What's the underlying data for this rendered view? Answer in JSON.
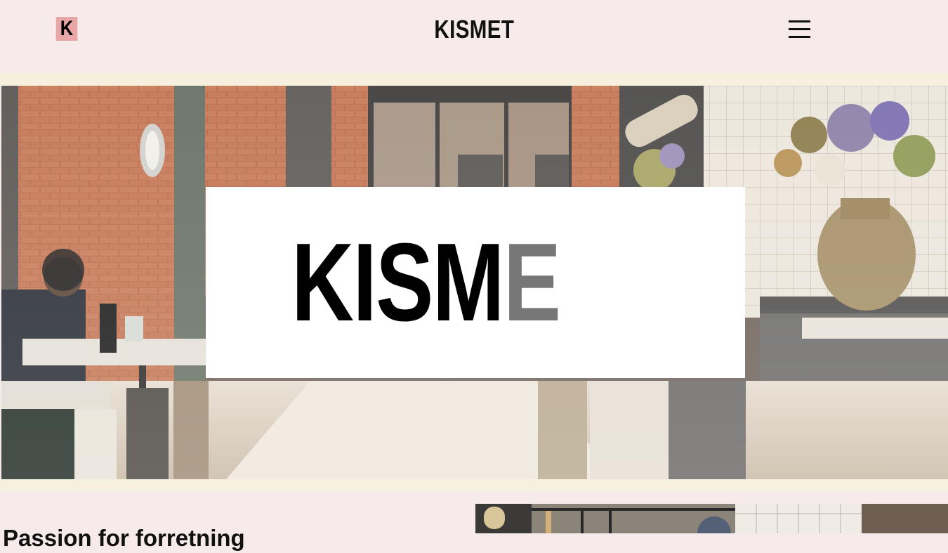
{
  "header": {
    "logo_letter": "K",
    "title": "KISMET",
    "menu_icon": "hamburger-menu-icon"
  },
  "hero": {
    "image_description_icon": "restaurant-interior-photo",
    "card_text_solid": "KISM",
    "card_text_faded": "E"
  },
  "section": {
    "heading": "Passion for forretning",
    "photo_icon": "kitchen-photo"
  },
  "colors": {
    "header_bg": "#f7eaea",
    "strip": "#f6f1df",
    "logo_badge": "#e8a6a6"
  }
}
